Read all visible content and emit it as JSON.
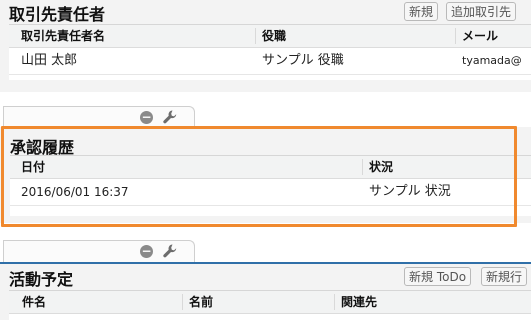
{
  "contacts": {
    "title": "取引先責任者",
    "new_button": "新規",
    "add_button": "追加取引先",
    "columns": [
      "取引先責任者名",
      "役職",
      "メール"
    ],
    "rows": [
      [
        "山田 太郎",
        "サンプル 役職",
        "tyamada@"
      ]
    ]
  },
  "approval": {
    "title": "承認履歴",
    "columns": [
      "日付",
      "状況"
    ],
    "rows": [
      [
        "2016/06/01 16:37",
        "サンプル 状況"
      ]
    ]
  },
  "activities": {
    "title": "活動予定",
    "new_todo_button": "新規 ToDo",
    "new_event_button": "新規行",
    "columns": [
      "件名",
      "名前",
      "関連先"
    ]
  },
  "colors": {
    "highlight": "#f0892e",
    "divider": "#2f6fa8"
  },
  "icons": [
    "minus-icon",
    "wrench-icon"
  ]
}
